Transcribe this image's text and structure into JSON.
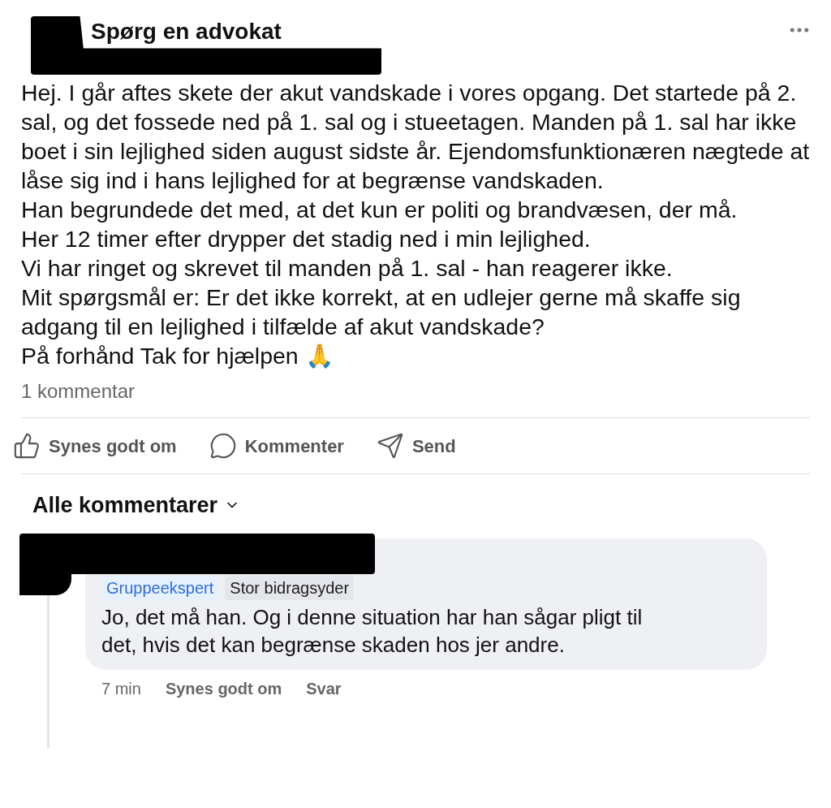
{
  "post": {
    "group_name": "Spørg en advokat",
    "paragraphs": [
      "Hej. I går aftes skete der akut vandskade i vores opgang. Det startede på 2. sal, og det fossede ned på 1. sal og i stueetagen. Manden på 1. sal har ikke boet i sin lejlighed siden august sidste år. Ejendomsfunktionæren nægtede at låse sig ind i hans lejlighed for at begrænse vandskaden.",
      "Han begrundede det med, at det kun er politi og brandvæsen, der må.",
      "Her 12 timer efter drypper det stadig ned i min lejlighed.",
      "Vi har ringet og skrevet til manden på 1. sal - han reagerer ikke.",
      "Mit spørgsmål er: Er det ikke korrekt, at en udlejer gerne må skaffe sig adgang til en lejlighed i tilfælde af akut vandskade?",
      "På forhånd Tak for hjælpen 🙏"
    ],
    "comment_count": "1 kommentar"
  },
  "actions": [
    {
      "kind": "like",
      "label": "Synes godt om"
    },
    {
      "kind": "comment",
      "label": "Kommenter"
    },
    {
      "kind": "send",
      "label": "Send"
    }
  ],
  "comments_header": "Alle kommentarer",
  "comments": [
    {
      "badges": [
        {
          "kind": "expert",
          "label": "Gruppeekspert"
        },
        {
          "kind": "contributor",
          "label": "Stor bidragsyder"
        }
      ],
      "text": "Jo, det må han. Og i denne situation har han sågar pligt til det, hvis det kan begrænse skaden hos jer andre.",
      "time": "7 min",
      "like_label": "Synes godt om",
      "reply_label": "Svar"
    }
  ]
}
